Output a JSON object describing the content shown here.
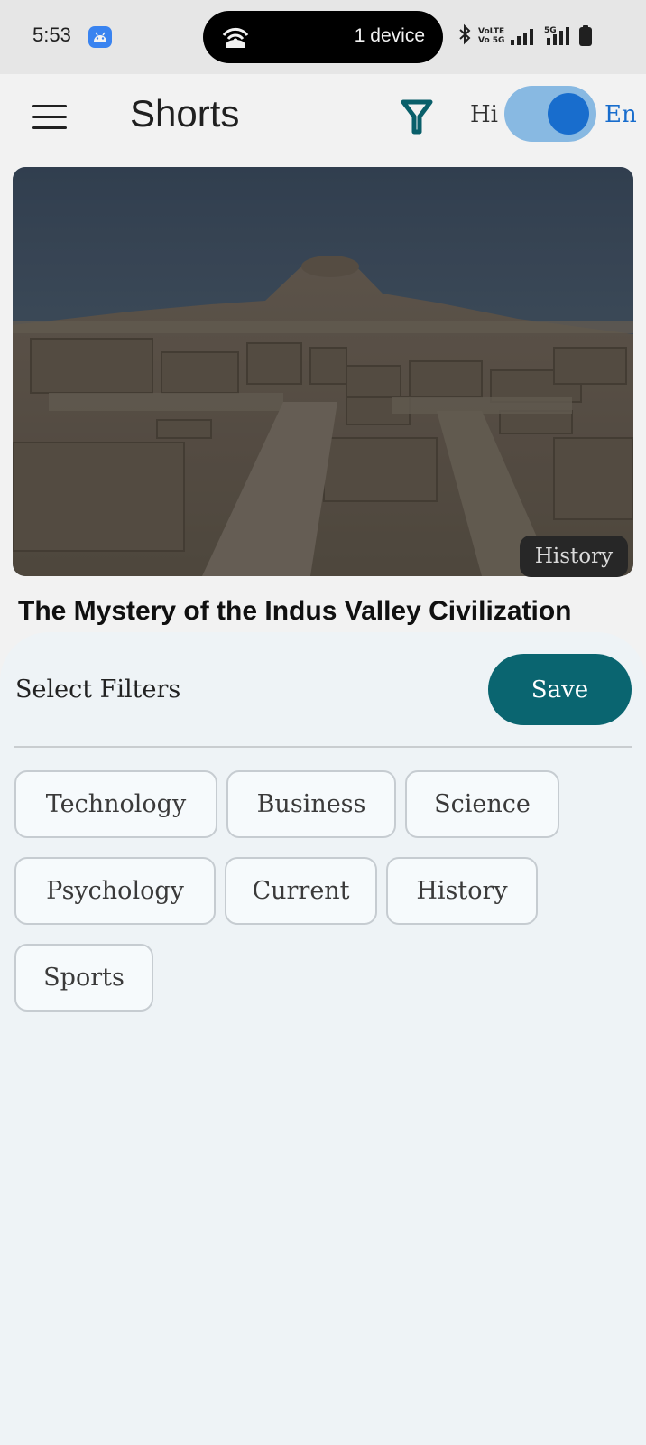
{
  "status_bar": {
    "time": "5:53",
    "hotspot_label": "1 device",
    "network_label_top": "VoLTE",
    "network_label_bottom": "Vo 5G",
    "network_5g": "5G"
  },
  "app_bar": {
    "title": "Shorts",
    "lang_left": "Hi",
    "lang_right": "En",
    "language_toggle_on": true
  },
  "card": {
    "category": "History",
    "title": "The Mystery of the Indus Valley Civilization"
  },
  "filter_sheet": {
    "heading": "Select Filters",
    "save_label": "Save",
    "chips": [
      "Technology",
      "Business",
      "Science",
      "Psychology",
      "Current",
      "History",
      "Sports"
    ]
  },
  "colors": {
    "accent": "#0a6570",
    "toggle_track": "#90c3ef",
    "toggle_knob": "#1a73d9",
    "sheet_background": "#eef3f6"
  }
}
